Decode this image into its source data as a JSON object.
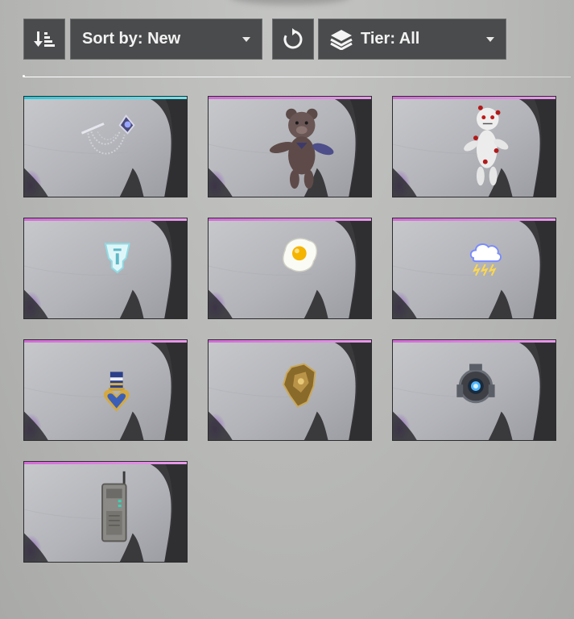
{
  "toolbar": {
    "sort_order_icon": "sort-descending-icon",
    "sort_label": "Sort by: New",
    "reset_icon": "refresh-icon",
    "tier_icon": "layers-icon",
    "tier_label": "Tier: All"
  },
  "colors": {
    "tier_cyan": "#2bc8d8",
    "tier_pink": "#d36ad6",
    "button_bg": "#4a4b4c",
    "panel_bg": "#b8b9b7"
  },
  "items": [
    {
      "icon": "silver-chain-brooch-icon",
      "tier": "cyan"
    },
    {
      "icon": "teddy-bear-icon",
      "tier": "pink"
    },
    {
      "icon": "voodoo-doll-icon",
      "tier": "pink"
    },
    {
      "icon": "emblem-badge-icon",
      "tier": "pink"
    },
    {
      "icon": "fried-egg-icon",
      "tier": "pink"
    },
    {
      "icon": "storm-cloud-icon",
      "tier": "pink"
    },
    {
      "icon": "heart-medal-icon",
      "tier": "pink"
    },
    {
      "icon": "gold-crest-icon",
      "tier": "pink"
    },
    {
      "icon": "tech-core-icon",
      "tier": "pink"
    },
    {
      "icon": "walkie-talkie-icon",
      "tier": "pink"
    }
  ]
}
